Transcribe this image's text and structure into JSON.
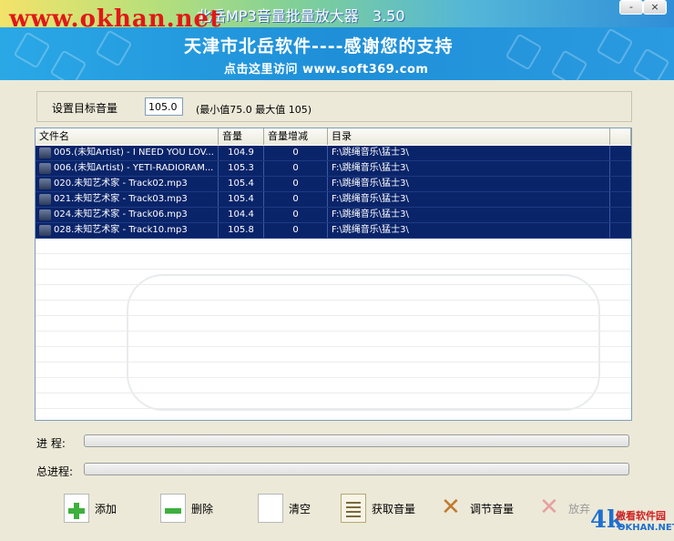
{
  "window": {
    "title": "北岳MP3音量批量放大器",
    "version": "3.50",
    "watermark": "www.okhan.net",
    "minimize_label": "-",
    "close_label": "×"
  },
  "banner": {
    "line1": "天津市北岳软件----感谢您的支持",
    "line2": "点击这里访问 www.soft369.com"
  },
  "target": {
    "label": "设置目标音量",
    "value": "105.0",
    "range_text": "(最小值75.0  最大值 105)"
  },
  "list": {
    "columns": [
      "文件名",
      "音量",
      "音量增减",
      "目录"
    ],
    "rows": [
      {
        "name": "005.(未知Artist) - I NEED YOU LOV...",
        "volume": "104.9",
        "gain": "0",
        "dir": "F:\\跳绳音乐\\猛士3\\"
      },
      {
        "name": "006.(未知Artist) - YETI-RADIORAM...",
        "volume": "105.3",
        "gain": "0",
        "dir": "F:\\跳绳音乐\\猛士3\\"
      },
      {
        "name": "020.未知艺术家 - Track02.mp3",
        "volume": "105.4",
        "gain": "0",
        "dir": "F:\\跳绳音乐\\猛士3\\"
      },
      {
        "name": "021.未知艺术家 - Track03.mp3",
        "volume": "105.4",
        "gain": "0",
        "dir": "F:\\跳绳音乐\\猛士3\\"
      },
      {
        "name": "024.未知艺术家 - Track06.mp3",
        "volume": "104.4",
        "gain": "0",
        "dir": "F:\\跳绳音乐\\猛士3\\"
      },
      {
        "name": "028.未知艺术家 - Track10.mp3",
        "volume": "105.8",
        "gain": "0",
        "dir": "F:\\跳绳音乐\\猛士3\\"
      }
    ]
  },
  "progress": {
    "label": "进  程:",
    "value": 0,
    "total_label": "总进程:",
    "total_value": 0
  },
  "toolbar": {
    "add": "添加",
    "delete": "删除",
    "clear": "清空",
    "get_volume": "获取音量",
    "adjust_volume": "调节音量",
    "cancel": "放弃"
  },
  "logo": {
    "k_glyph": "4k",
    "text1": "傲看软件园",
    "text2": "OKHAN.NET"
  }
}
